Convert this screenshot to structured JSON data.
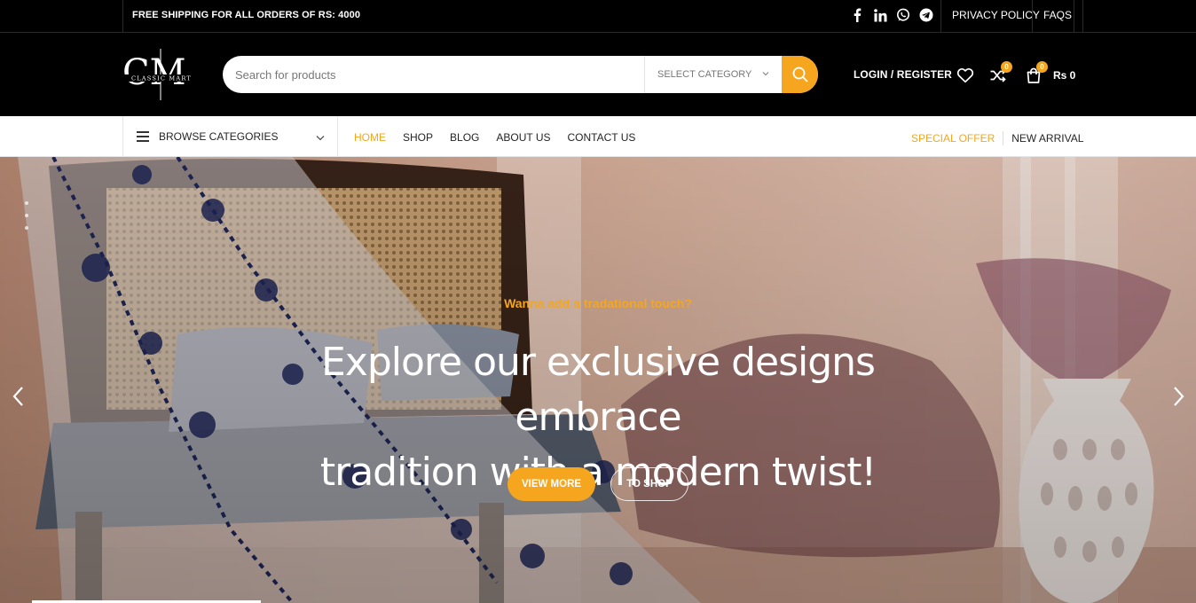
{
  "topbar": {
    "shipping_text": "FREE SHIPPING FOR ALL ORDERS OF RS: 4000",
    "social_icons": [
      "facebook-icon",
      "linkedin-icon",
      "whatsapp-icon",
      "telegram-icon"
    ],
    "links": {
      "privacy": "PRIVACY POLICY",
      "faqs": "FAQS"
    }
  },
  "header": {
    "logo_letters": "CM",
    "logo_text": "CLASSIC MART",
    "search": {
      "placeholder": "Search for products",
      "category_label": "SELECT CATEGORY"
    },
    "login_label": "LOGIN / REGISTER",
    "compare_count": "0",
    "cart_count": "0",
    "cart_total": "Rs 0"
  },
  "nav": {
    "browse_label": "BROWSE CATEGORIES",
    "items": [
      "HOME",
      "SHOP",
      "BLOG",
      "ABOUT US",
      "CONTACT US"
    ],
    "right_items": [
      "SPECIAL OFFER",
      "NEW ARRIVAL"
    ]
  },
  "hero": {
    "subtitle": "Wanna add a tradational touch?",
    "headline_line1": "Explore our exclusive designs embrace",
    "headline_line2": "tradition with a modern twist!",
    "primary_button": "VIEW MORE",
    "secondary_button": "TO SHOP"
  },
  "colors": {
    "accent": "#f5a61e",
    "topbar_bg": "#000000",
    "nav_bg": "#ffffff"
  }
}
